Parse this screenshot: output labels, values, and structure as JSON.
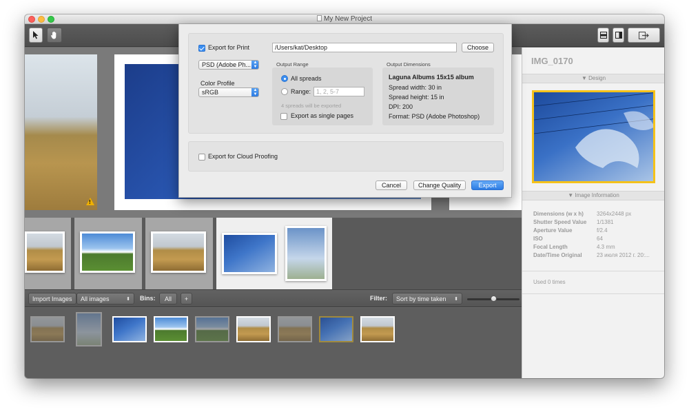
{
  "window": {
    "title": "My New Project"
  },
  "toolbar": {
    "select_tool": "arrow-pointer-icon",
    "hand_tool": "hand-icon",
    "layout_single": "single-view-icon",
    "layout_split": "split-view-icon",
    "export_button": "export-icon"
  },
  "export_sheet": {
    "export_for_print_label": "Export for Print",
    "export_for_print_checked": true,
    "path_value": "/Users/kat/Desktop",
    "choose_label": "Choose",
    "format_value": "PSD (Adobe Ph...",
    "color_profile_label": "Color Profile",
    "color_profile_value": "sRGB",
    "output_range": {
      "heading": "Output Range",
      "all_spreads": "All spreads",
      "range_label": "Range:",
      "range_placeholder": "1, 2, 5-7",
      "note": "4 spreads will be exported",
      "single_pages": "Export as single pages"
    },
    "output_dimensions": {
      "heading": "Output Dimensions",
      "album": "Laguna Albums 15x15 album",
      "spread_width": "Spread width: 30 in",
      "spread_height": "Spread height: 15 in",
      "dpi": "DPI: 200",
      "format": "Format: PSD (Adobe Photoshop)"
    },
    "cloud_proofing_label": "Export for Cloud Proofing",
    "cancel_label": "Cancel",
    "change_quality_label": "Change Quality",
    "export_label": "Export"
  },
  "library_bar": {
    "import_label": "Import Images",
    "source_value": "All images",
    "bins_label": "Bins:",
    "bins_all": "All",
    "bins_add": "+",
    "filter_label": "Filter:",
    "sort_value": "Sort by time taken"
  },
  "inspector": {
    "image_name": "IMG_0170",
    "design_section": "▼ Design",
    "info_section": "▼ Image Information",
    "rows": [
      {
        "key": "Dimensions (w x h)",
        "value": "3264x2448 px"
      },
      {
        "key": "Shutter Speed Value",
        "value": "1/1381"
      },
      {
        "key": "Aperture Value",
        "value": "f/2.4"
      },
      {
        "key": "ISO",
        "value": "64"
      },
      {
        "key": "Focal Length",
        "value": "4.3 mm"
      },
      {
        "key": "Date/Time Original",
        "value": "23 июля 2012 г. 20:..."
      }
    ],
    "used": "Used 0 times"
  },
  "stage": {
    "warning_icon": "warning-icon"
  }
}
